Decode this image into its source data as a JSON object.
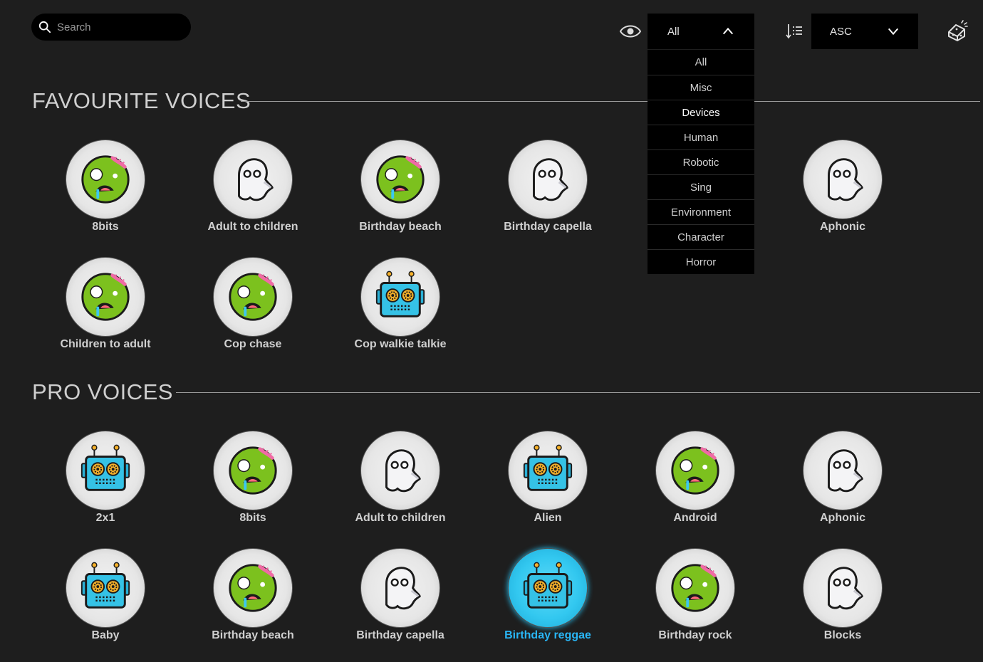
{
  "search": {
    "placeholder": "Search"
  },
  "filter": {
    "selected": "All",
    "options": [
      "All",
      "Misc",
      "Devices",
      "Human",
      "Robotic",
      "Sing",
      "Environment",
      "Character",
      "Horror"
    ],
    "hovered": "Devices"
  },
  "order": {
    "selected": "ASC"
  },
  "sections": {
    "favourite": {
      "title": "FAVOURITE VOICES",
      "voices": [
        {
          "name": "8bits",
          "icon": "zombie"
        },
        {
          "name": "Adult to children",
          "icon": "ghost"
        },
        {
          "name": "Birthday beach",
          "icon": "zombie"
        },
        {
          "name": "Birthday capella",
          "icon": "ghost"
        },
        {
          "name": "Aphonic",
          "icon": "ghost"
        },
        {
          "name": "Children to adult",
          "icon": "zombie"
        },
        {
          "name": "Cop chase",
          "icon": "zombie"
        },
        {
          "name": "Cop walkie talkie",
          "icon": "robot"
        }
      ]
    },
    "pro": {
      "title": "PRO VOICES",
      "voices": [
        {
          "name": "2x1",
          "icon": "robot"
        },
        {
          "name": "8bits",
          "icon": "zombie"
        },
        {
          "name": "Adult to children",
          "icon": "ghost"
        },
        {
          "name": "Alien",
          "icon": "robot"
        },
        {
          "name": "Android",
          "icon": "zombie"
        },
        {
          "name": "Aphonic",
          "icon": "ghost"
        },
        {
          "name": "Baby",
          "icon": "robot"
        },
        {
          "name": "Birthday beach",
          "icon": "zombie"
        },
        {
          "name": "Birthday capella",
          "icon": "ghost"
        },
        {
          "name": "Birthday reggae",
          "icon": "robot",
          "selected": true
        },
        {
          "name": "Birthday rock",
          "icon": "zombie"
        },
        {
          "name": "Blocks",
          "icon": "ghost"
        }
      ]
    }
  },
  "colors": {
    "accent": "#29b6f6",
    "background": "#1e1e1e"
  }
}
